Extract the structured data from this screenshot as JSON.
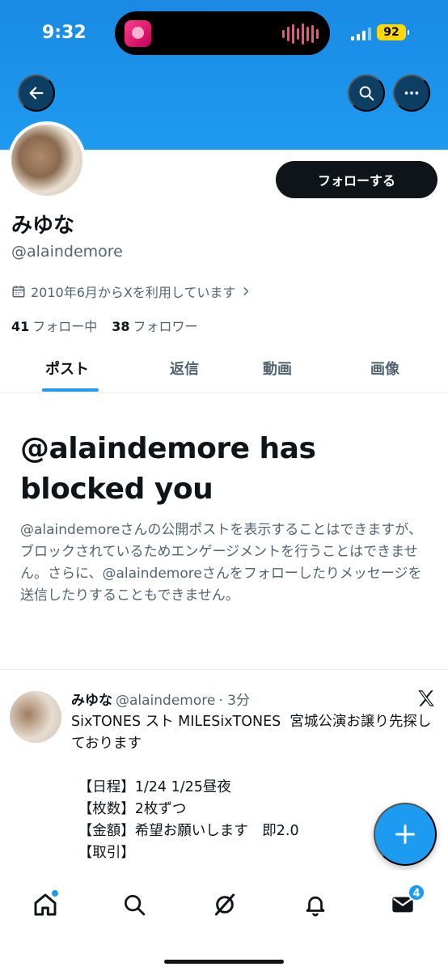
{
  "status_bar": {
    "time": "9:32",
    "battery": "92"
  },
  "profile": {
    "display_name": "みゆな",
    "handle": "@alaindemore",
    "joined": "2010年6月からXを利用しています",
    "following_count": "41",
    "following_label": "フォロー中",
    "followers_count": "38",
    "followers_label": "フォロワー",
    "follow_button": "フォローする"
  },
  "tabs": [
    {
      "label": "ポスト",
      "active": true
    },
    {
      "label": "返信",
      "active": false
    },
    {
      "label": "動画",
      "active": false
    },
    {
      "label": "画像",
      "active": false
    }
  ],
  "blocked": {
    "title": "@alaindemore has blocked you",
    "body": "@alaindemoreさんの公開ポストを表示することはできますが、ブロックされているためエンゲージメントを行うことはできません。さらに、@alaindemoreさんをフォローしたりメッセージを送信したりすることもできません。"
  },
  "post": {
    "name": "みゆな",
    "handle": "@alaindemore",
    "time": "· 3分",
    "text": "SixTONES スト MILESixTONES  宮城公演お譲り先探しております\n\n　【日程】1/24 1/25昼夜\n　【枚数】2枚ずつ\n　【金額】希望お願いします　即2.0\n　【取引】"
  },
  "nav": {
    "messages_badge": "4"
  },
  "colors": {
    "accent": "#1d9bf0",
    "banner": "#1d9bf0",
    "text": "#0f1419",
    "secondary": "#536471"
  }
}
